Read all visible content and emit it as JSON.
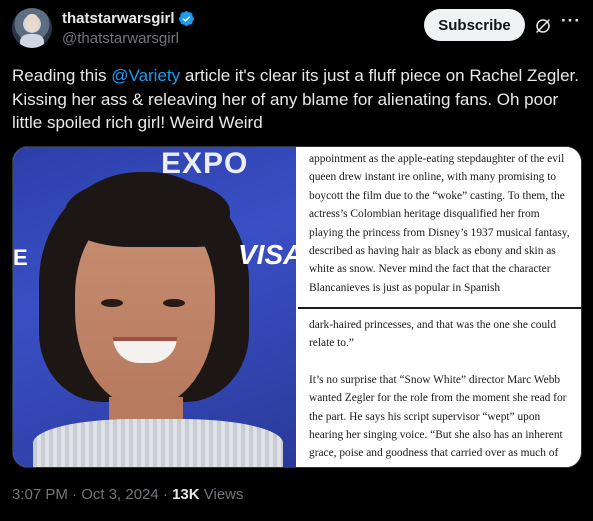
{
  "author": {
    "display_name": "thatstarwarsgirl",
    "handle": "@thatstarwarsgirl",
    "verified_icon": "verified-badge-icon"
  },
  "actions": {
    "subscribe_label": "Subscribe",
    "grok_icon": "grok-icon",
    "more_icon": "more-options-icon"
  },
  "tweet": {
    "text_before": "Reading this ",
    "mention": "@Variety",
    "text_after": " article it's clear its just a fluff piece on Rachel Zegler. Kissing her ass & releaving her of any blame for alienating fans. Oh poor little spoiled rich girl! Weird Weird"
  },
  "media": {
    "photo_signage": {
      "expo": "EXPO",
      "visa": "VISA",
      "e": "E"
    },
    "article_top": "appointment as the apple-eating stepdaughter of the evil queen drew instant ire online, with many promising to boycott the film due to the “woke” casting. To them, the actress’s Colombian heritage disqualified her from playing the princess from Disney’s 1937 musical fantasy, described as having hair as black as ebony and skin as white as snow. Never mind the fact that the character Blancanieves is just as popular in Spanish",
    "article_bottom_1": "dark-haired princesses, and that was the one she could relate to.”",
    "article_bottom_2": "It’s no surprise that “Snow White” director Marc Webb wanted Zegler for the role from the moment she read for the part. He says his script supervisor “wept” upon hearing her singing voice. “But she also has an inherent grace, poise and goodness that carried over as much of what it was to play"
  },
  "footer": {
    "timestamp": "3:07 PM · Oct 3, 2024 · ",
    "views_count": "13K",
    "views_label": " Views"
  },
  "colors": {
    "accent": "#1d9bf0",
    "background": "#000000",
    "secondary_text": "#71767b"
  }
}
